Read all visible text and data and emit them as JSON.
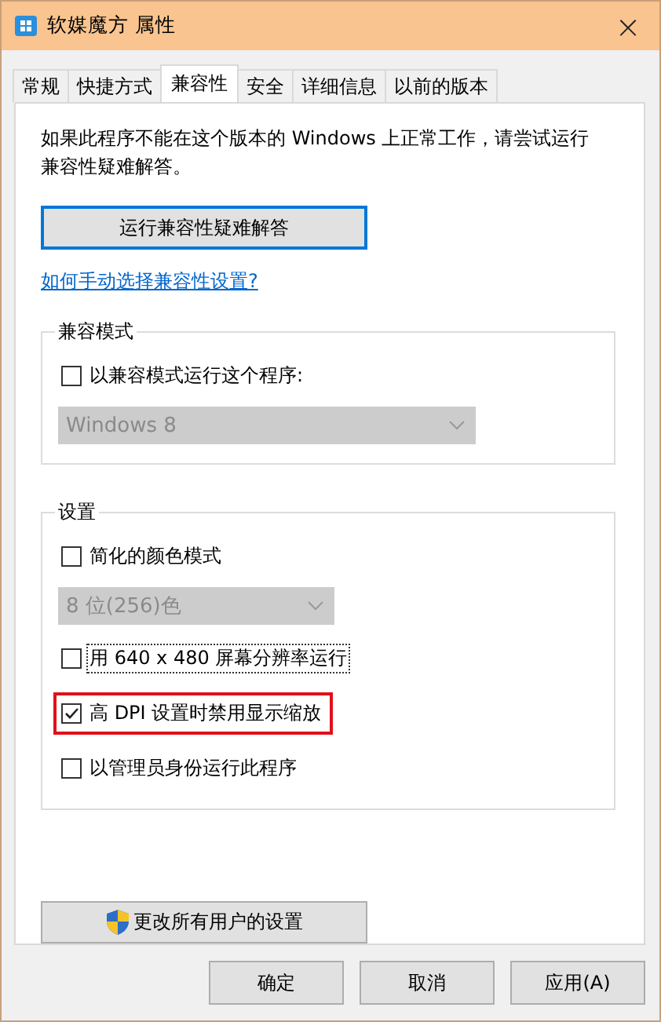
{
  "window": {
    "title": "软媒魔方 属性",
    "close": "×"
  },
  "tabs": [
    {
      "label": "常规",
      "selected": false
    },
    {
      "label": "快捷方式",
      "selected": false
    },
    {
      "label": "兼容性",
      "selected": true
    },
    {
      "label": "安全",
      "selected": false
    },
    {
      "label": "详细信息",
      "selected": false
    },
    {
      "label": "以前的版本",
      "selected": false
    }
  ],
  "intro": "如果此程序不能在这个版本的 Windows 上正常工作，请尝试运行兼容性疑难解答。",
  "troubleshoot_button": {
    "label": "运行兼容性疑难解答",
    "focused": true
  },
  "help_link": "如何手动选择兼容性设置?",
  "groups": [
    {
      "title": "兼容模式",
      "items": [
        {
          "kind": "checkbox",
          "label": "以兼容模式运行这个程序:",
          "checked": false,
          "highlighted": false,
          "focused": false
        },
        {
          "kind": "dropdown",
          "value": "Windows 8",
          "disabled": true,
          "wide": true
        }
      ]
    },
    {
      "title": "设置",
      "items": [
        {
          "kind": "checkbox",
          "label": "简化的颜色模式",
          "checked": false,
          "highlighted": false,
          "focused": false
        },
        {
          "kind": "dropdown",
          "value": "8 位(256)色",
          "disabled": true,
          "wide": false
        },
        {
          "kind": "checkbox",
          "label": "用 640 x 480 屏幕分辨率运行",
          "checked": false,
          "highlighted": false,
          "focused": true
        },
        {
          "kind": "checkbox",
          "label": "高 DPI 设置时禁用显示缩放",
          "checked": true,
          "highlighted": true,
          "focused": false
        },
        {
          "kind": "checkbox",
          "label": "以管理员身份运行此程序",
          "checked": false,
          "highlighted": false,
          "focused": false
        }
      ]
    }
  ],
  "all_users_button": {
    "label": "更改所有用户的设置"
  },
  "buttons": [
    "确定",
    "取消",
    "应用(A)"
  ]
}
